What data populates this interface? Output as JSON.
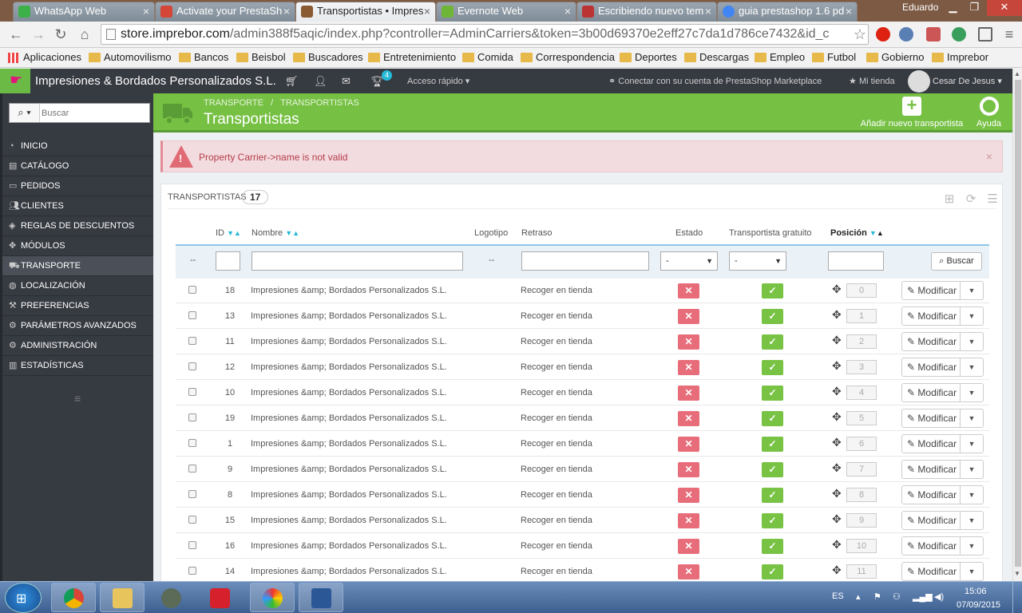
{
  "browser": {
    "tabs": [
      {
        "title": "WhatsApp Web",
        "icon": "whatsapp-icon",
        "color": "#3cb14a"
      },
      {
        "title": "Activate your PrestaSh",
        "icon": "gmail-icon",
        "color": "#d44638"
      },
      {
        "title": "Transportistas • Impres",
        "icon": "prestashop-icon",
        "color": "#8a5a33"
      },
      {
        "title": "Evernote Web",
        "icon": "evernote-icon",
        "color": "#6fb536"
      },
      {
        "title": "Escribiendo nuevo tem",
        "icon": "forum-icon",
        "color": "#b33"
      },
      {
        "title": "guia prestashop 1.6 pd",
        "icon": "google-icon",
        "color": "#4285f4"
      }
    ],
    "user": "Eduardo",
    "url_host": "store.imprebor.com",
    "url_path": "/admin388f5aqic/index.php?controller=AdminCarriers&token=3b00d69370e2eff27c7da1d786ce7432&id_c",
    "bookmarks": [
      "Aplicaciones",
      "Automovilismo",
      "Bancos",
      "Beisbol",
      "Buscadores",
      "Entretenimiento",
      "Comida",
      "Correspondencia",
      "Deportes",
      "Descargas",
      "Empleo",
      "Futbol",
      "Gobierno",
      "Imprebor"
    ]
  },
  "header": {
    "shop_name": "Impresiones & Bordados Personalizados S.L.",
    "notifications": "4",
    "quick_access": "Acceso rápido",
    "marketplace": "Conectar con su cuenta de PrestaShop Marketplace",
    "my_shop": "Mi tienda",
    "user": "Cesar De Jesus"
  },
  "sidebar": {
    "search_placeholder": "Buscar",
    "items": [
      {
        "label": "INICIO",
        "icon": "dashboard-icon"
      },
      {
        "label": "CATÁLOGO",
        "icon": "book-icon"
      },
      {
        "label": "PEDIDOS",
        "icon": "orders-icon"
      },
      {
        "label": "CLIENTES",
        "icon": "users-icon"
      },
      {
        "label": "REGLAS DE DESCUENTOS",
        "icon": "tag-icon"
      },
      {
        "label": "MÓDULOS",
        "icon": "puzzle-icon"
      },
      {
        "label": "TRANSPORTE",
        "icon": "truck-icon"
      },
      {
        "label": "LOCALIZACIÓN",
        "icon": "globe-icon"
      },
      {
        "label": "PREFERENCIAS",
        "icon": "wrench-icon"
      },
      {
        "label": "PARÁMETROS AVANZADOS",
        "icon": "cogs-icon"
      },
      {
        "label": "ADMINISTRACIÓN",
        "icon": "cog-icon"
      },
      {
        "label": "ESTADÍSTICAS",
        "icon": "bar-chart-icon"
      }
    ],
    "active": "TRANSPORTE"
  },
  "page_head": {
    "breadcrumb_1": "TRANSPORTE",
    "breadcrumb_2": "TRANSPORTISTAS",
    "title": "Transportistas",
    "add_label": "Añadir nuevo transportista",
    "help_label": "Ayuda"
  },
  "alert": {
    "message": "Property Carrier->name is not valid",
    "close": "×"
  },
  "panel": {
    "title": "TRANSPORTISTAS",
    "count": "17",
    "columns": {
      "id": "ID",
      "name": "Nombre",
      "logo": "Logotipo",
      "delay": "Retraso",
      "status": "Estado",
      "free": "Transportista gratuito",
      "position": "Posición"
    },
    "filter": {
      "dash": "--",
      "select_default": "-",
      "search_label": "Buscar"
    },
    "edit_label": "Modificar",
    "rows": [
      {
        "id": "18",
        "name": "Impresiones &amp; Bordados Personalizados S.L.",
        "delay": "Recoger en tienda",
        "position": "0"
      },
      {
        "id": "13",
        "name": "Impresiones &amp; Bordados Personalizados S.L.",
        "delay": "Recoger en tienda",
        "position": "1"
      },
      {
        "id": "11",
        "name": "Impresiones &amp; Bordados Personalizados S.L.",
        "delay": "Recoger en tienda",
        "position": "2"
      },
      {
        "id": "12",
        "name": "Impresiones &amp; Bordados Personalizados S.L.",
        "delay": "Recoger en tienda",
        "position": "3"
      },
      {
        "id": "10",
        "name": "Impresiones &amp; Bordados Personalizados S.L.",
        "delay": "Recoger en tienda",
        "position": "4"
      },
      {
        "id": "19",
        "name": "Impresiones &amp; Bordados Personalizados S.L.",
        "delay": "Recoger en tienda",
        "position": "5"
      },
      {
        "id": "1",
        "name": "Impresiones &amp; Bordados Personalizados S.L.",
        "delay": "Recoger en tienda",
        "position": "6"
      },
      {
        "id": "9",
        "name": "Impresiones &amp; Bordados Personalizados S.L.",
        "delay": "Recoger en tienda",
        "position": "7"
      },
      {
        "id": "8",
        "name": "Impresiones &amp; Bordados Personalizados S.L.",
        "delay": "Recoger en tienda",
        "position": "8"
      },
      {
        "id": "15",
        "name": "Impresiones &amp; Bordados Personalizados S.L.",
        "delay": "Recoger en tienda",
        "position": "9"
      },
      {
        "id": "16",
        "name": "Impresiones &amp; Bordados Personalizados S.L.",
        "delay": "Recoger en tienda",
        "position": "10"
      },
      {
        "id": "14",
        "name": "Impresiones &amp; Bordados Personalizados S.L.",
        "delay": "Recoger en tienda",
        "position": "11"
      }
    ]
  },
  "taskbar": {
    "language": "ES",
    "time": "15:06",
    "date": "07/09/2015"
  }
}
